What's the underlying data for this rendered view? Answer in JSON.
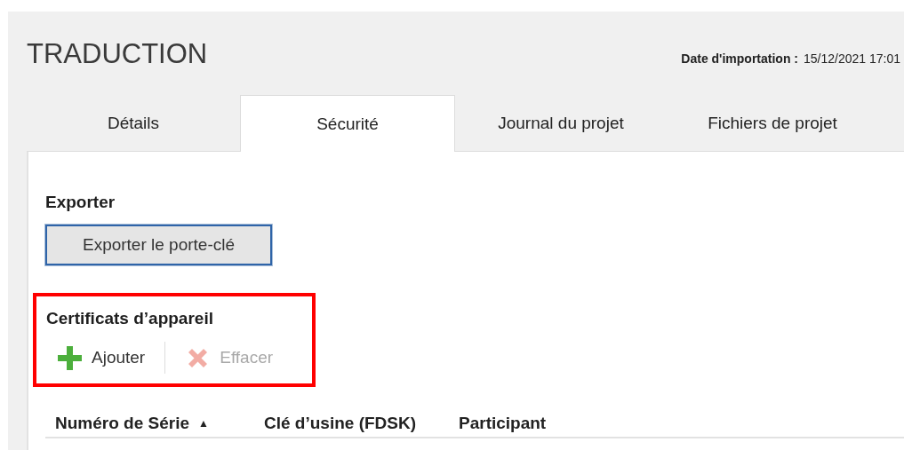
{
  "page": {
    "title": "TRADUCTION",
    "import_label": "Date d'importation :",
    "import_value": "15/12/2021 17:01"
  },
  "tabs": [
    {
      "label": "Détails",
      "selected": false
    },
    {
      "label": "Sécurité",
      "selected": true
    },
    {
      "label": "Journal du projet",
      "selected": false
    },
    {
      "label": "Fichiers de projet",
      "selected": false
    }
  ],
  "export": {
    "heading": "Exporter",
    "button": "Exporter le porte-clé"
  },
  "certificates": {
    "heading": "Certificats d’appareil",
    "highlighted": true,
    "actions": [
      {
        "kind": "add",
        "label": "Ajouter",
        "disabled": false
      },
      {
        "kind": "delete",
        "label": "Effacer",
        "disabled": true
      }
    ]
  },
  "table": {
    "columns": [
      {
        "label": "Numéro de Série",
        "sort_indicator": "▲"
      },
      {
        "label": "Clé d’usine (FDSK)"
      },
      {
        "label": "Participant"
      }
    ]
  }
}
